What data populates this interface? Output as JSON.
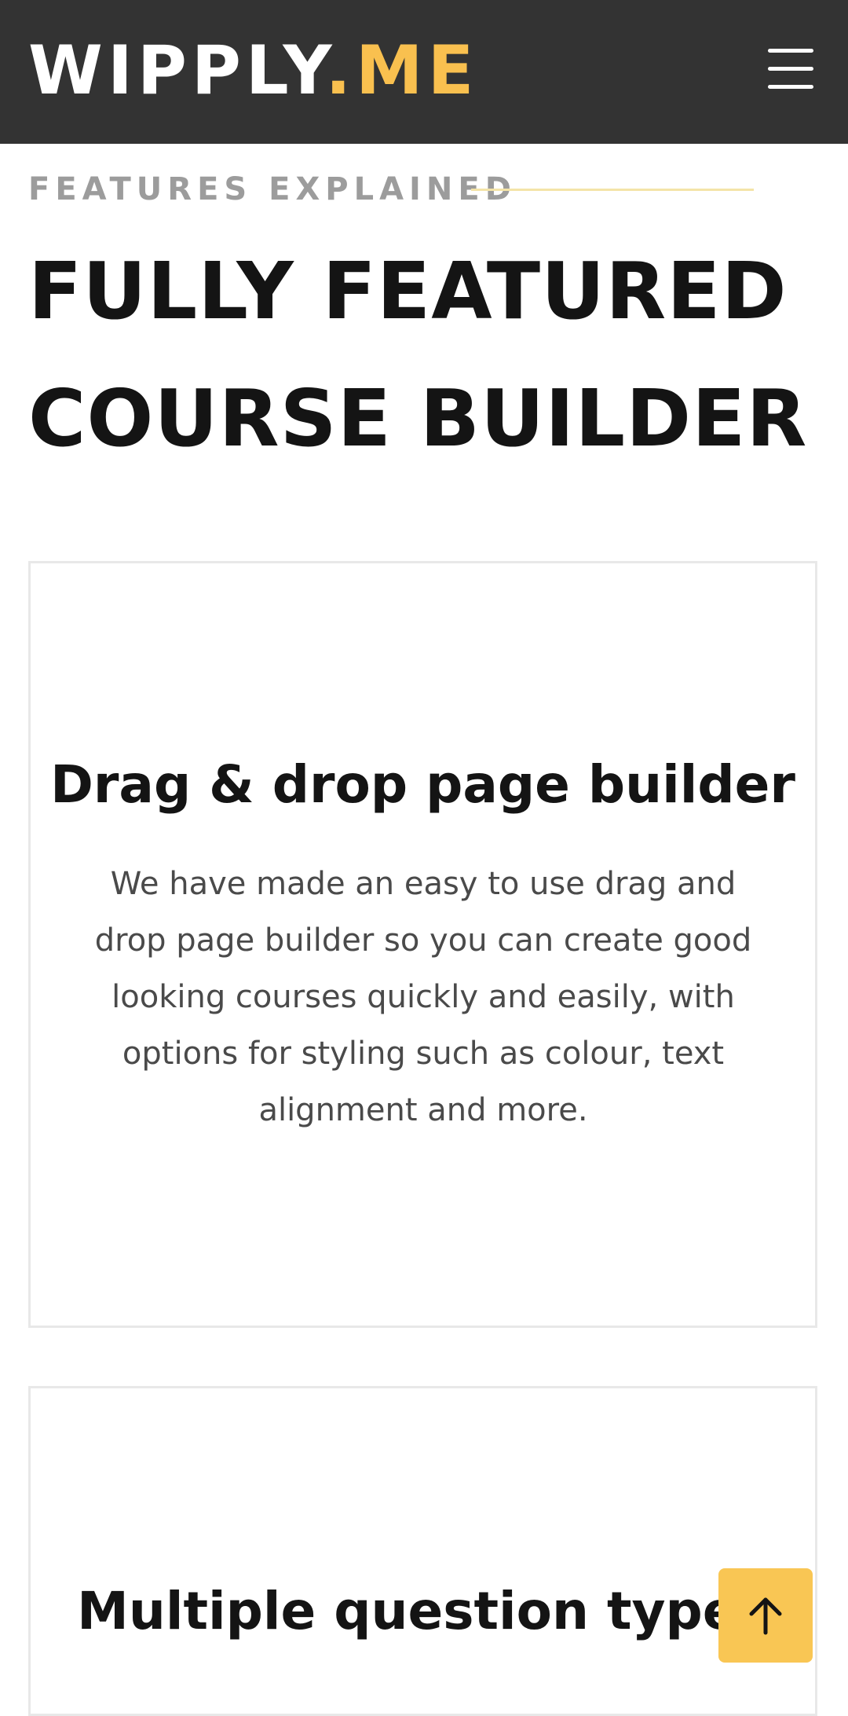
{
  "header": {
    "logo_main": "WIPPLY",
    "logo_accent": ".ME",
    "menu_icon": "hamburger-menu-icon",
    "accent_color": "#f9c04f",
    "background_color": "#333333"
  },
  "section": {
    "eyebrow": "FEATURES EXPLAINED",
    "headline": "FULLY FEATURED COURSE BUILDER"
  },
  "cards": [
    {
      "title": "Drag & drop page builder",
      "text": "We have made an easy to use drag and drop page builder so you can create good looking courses quickly and easily, with options for styling such as colour, text alignment and more."
    },
    {
      "title": "Multiple question types"
    }
  ],
  "back_to_top": {
    "icon": "arrow-up-icon",
    "color": "#f9c654"
  }
}
